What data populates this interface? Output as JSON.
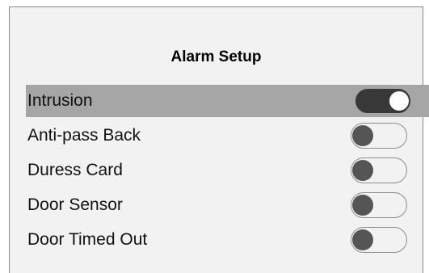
{
  "screen": {
    "title": "Alarm Setup"
  },
  "alarms": [
    {
      "label": "Intrusion",
      "enabled": true,
      "selected": true
    },
    {
      "label": "Anti-pass Back",
      "enabled": false,
      "selected": false
    },
    {
      "label": "Duress Card",
      "enabled": false,
      "selected": false
    },
    {
      "label": "Door Sensor",
      "enabled": false,
      "selected": false
    },
    {
      "label": "Door Timed Out",
      "enabled": false,
      "selected": false
    }
  ],
  "colors": {
    "background": "#f2f2f2",
    "selected_row": "#a6a6a6",
    "toggle_on": "#383838",
    "toggle_off_knob": "#555555"
  }
}
